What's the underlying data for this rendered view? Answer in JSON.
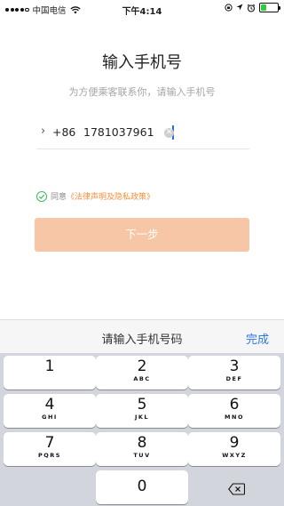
{
  "status_bar": {
    "carrier": "中国电信",
    "time": "下午4:14",
    "battery_level": 0.35,
    "battery_color": "#2ecc40"
  },
  "title": "输入手机号",
  "subtitle": "为方便乘客联系你，请输入手机号",
  "phone_input": {
    "country_code": "+86",
    "value": "1781037961"
  },
  "agreement": {
    "prefix": "同意",
    "link": "《法律声明及隐私政策》",
    "checked": true
  },
  "next_button": {
    "label": "下一步"
  },
  "keyboard": {
    "hint": "请输入手机号码",
    "done": "完成",
    "keys": [
      {
        "digit": "1",
        "letters": ""
      },
      {
        "digit": "2",
        "letters": "ABC"
      },
      {
        "digit": "3",
        "letters": "DEF"
      },
      {
        "digit": "4",
        "letters": "GHI"
      },
      {
        "digit": "5",
        "letters": "JKL"
      },
      {
        "digit": "6",
        "letters": "MNO"
      },
      {
        "digit": "7",
        "letters": "PQRS"
      },
      {
        "digit": "8",
        "letters": "TUV"
      },
      {
        "digit": "9",
        "letters": "WXYZ"
      },
      {
        "digit": "0",
        "letters": ""
      }
    ]
  },
  "colors": {
    "accent": "#f6c6a7",
    "link": "#f2913f",
    "check": "#3dbb5c",
    "done": "#2878e6"
  }
}
